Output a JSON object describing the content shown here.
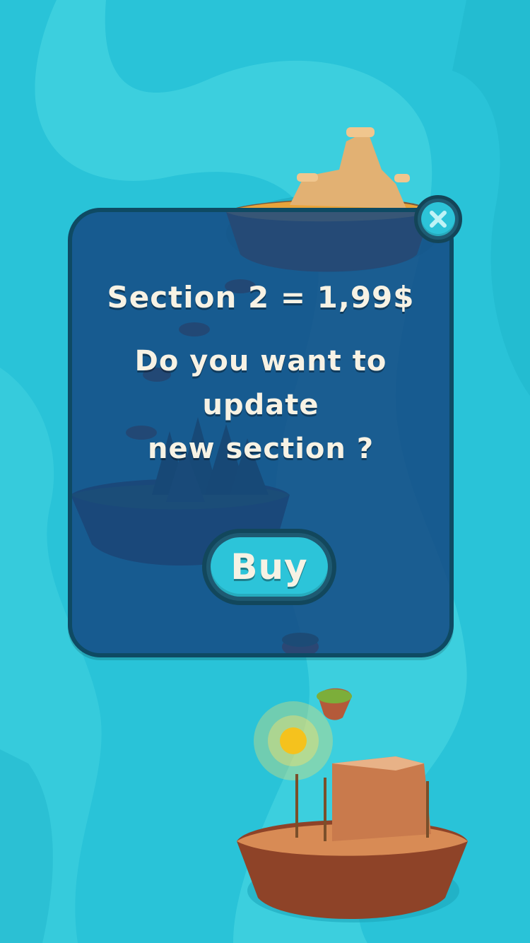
{
  "popup": {
    "price_text": "Section 2 = 1,99$",
    "question_line1": "Do you want to update",
    "question_line2": "new section ?",
    "buy_label": "Buy",
    "close_icon": "close-icon"
  },
  "colors": {
    "water": "#2ac4d9",
    "popup_fill": "#144882",
    "popup_border": "#0e4a63",
    "button_fill": "#2cc4d9",
    "text": "#f7f2e4"
  }
}
